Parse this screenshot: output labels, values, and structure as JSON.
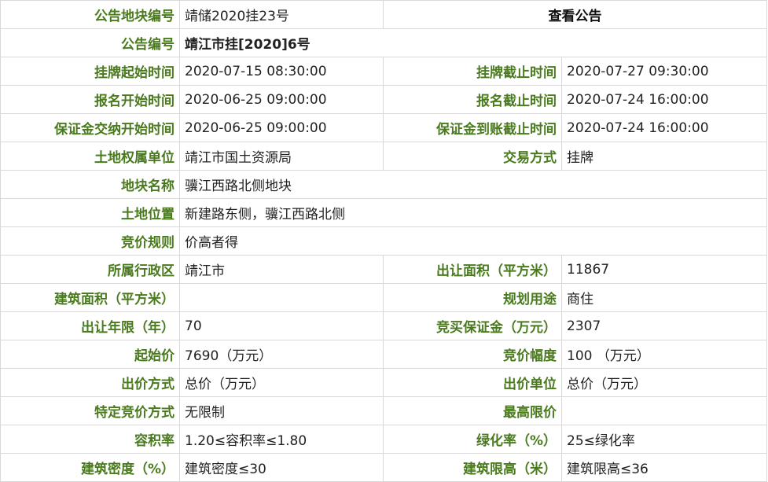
{
  "rows": [
    {
      "l1": "公告地块编号",
      "v1": "靖储2020挂23号",
      "link": "查看公告"
    },
    {
      "l1": "公告编号",
      "v1": "靖江市挂[2020]6号"
    },
    {
      "l1": "挂牌起始时间",
      "v1": "2020-07-15 08:30:00",
      "l2": "挂牌截止时间",
      "v2": "2020-07-27 09:30:00"
    },
    {
      "l1": "报名开始时间",
      "v1": "2020-06-25 09:00:00",
      "l2": "报名截止时间",
      "v2": "2020-07-24 16:00:00"
    },
    {
      "l1": "保证金交纳开始时间",
      "v1": "2020-06-25 09:00:00",
      "l2": "保证金到账截止时间",
      "v2": "2020-07-24 16:00:00"
    },
    {
      "l1": "土地权属单位",
      "v1": "靖江市国土资源局",
      "l2": "交易方式",
      "v2": "挂牌"
    },
    {
      "l1": "地块名称",
      "v1": "骥江西路北侧地块"
    },
    {
      "l1": "土地位置",
      "v1": "新建路东侧，骥江西路北侧"
    },
    {
      "l1": "竞价规则",
      "v1": "价高者得"
    },
    {
      "l1": "所属行政区",
      "v1": "靖江市",
      "l2": "出让面积（平方米）",
      "v2": "11867"
    },
    {
      "l1": "建筑面积（平方米）",
      "v1": "",
      "l2": "规划用途",
      "v2": "商住"
    },
    {
      "l1": "出让年限（年）",
      "v1": "70",
      "l2": "竞买保证金（万元）",
      "v2": "2307"
    },
    {
      "l1": "起始价",
      "v1": "7690（万元）",
      "l2": "竞价幅度",
      "v2": "100 （万元）"
    },
    {
      "l1": "出价方式",
      "v1": "总价（万元）",
      "l2": "出价单位",
      "v2": "总价（万元）"
    },
    {
      "l1": "特定竞价方式",
      "v1": "无限制",
      "l2": "最高限价",
      "v2": ""
    },
    {
      "l1": "容积率",
      "v1": "1.20≤容积率≤1.80",
      "l2": "绿化率（%）",
      "v2": "25≤绿化率"
    },
    {
      "l1": "建筑密度（%）",
      "v1": "建筑密度≤30",
      "l2": "建筑限高（米）",
      "v2": "建筑限高≤36"
    }
  ]
}
